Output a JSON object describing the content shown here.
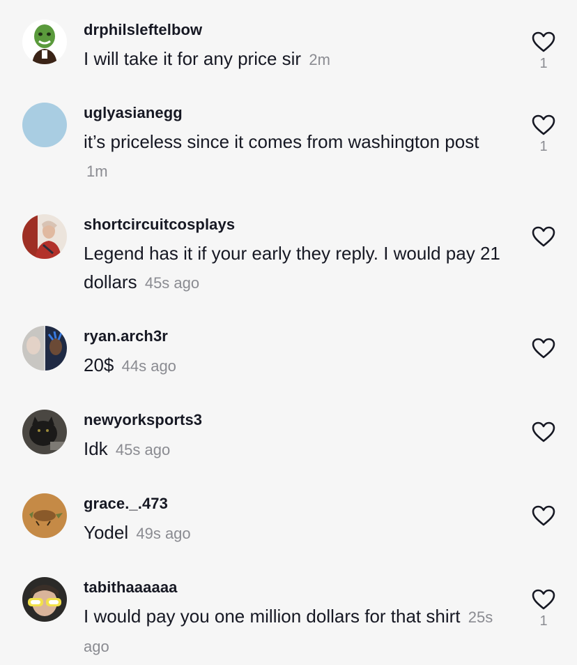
{
  "comments": [
    {
      "username": "drphilsleftelbow",
      "text": "I will take it for any price sir",
      "time": "2m",
      "likes": "1"
    },
    {
      "username": "uglyasianegg",
      "text": "it’s priceless since it comes from washington post",
      "time": "1m",
      "likes": "1"
    },
    {
      "username": "shortcircuitcosplays",
      "text": "Legend has it if your early they reply. I would pay 21 dollars",
      "time": "45s ago",
      "likes": ""
    },
    {
      "username": "ryan.arch3r",
      "text": "20$",
      "time": "44s ago",
      "likes": ""
    },
    {
      "username": "newyorksports3",
      "text": "Idk",
      "time": "45s ago",
      "likes": ""
    },
    {
      "username": "grace._.473",
      "text": "Yodel",
      "time": "49s ago",
      "likes": ""
    },
    {
      "username": "tabithaaaaaa",
      "text": "I would pay you one million dollars for that shirt",
      "time": "25s ago",
      "likes": "1"
    }
  ],
  "icons": {
    "like": "heart-outline-icon",
    "avatar": "avatar-image"
  },
  "colors": {
    "background": "#f6f6f6",
    "text": "#161823",
    "muted": "#8a8b91",
    "avatar_placeholder": "#a9cde2"
  }
}
